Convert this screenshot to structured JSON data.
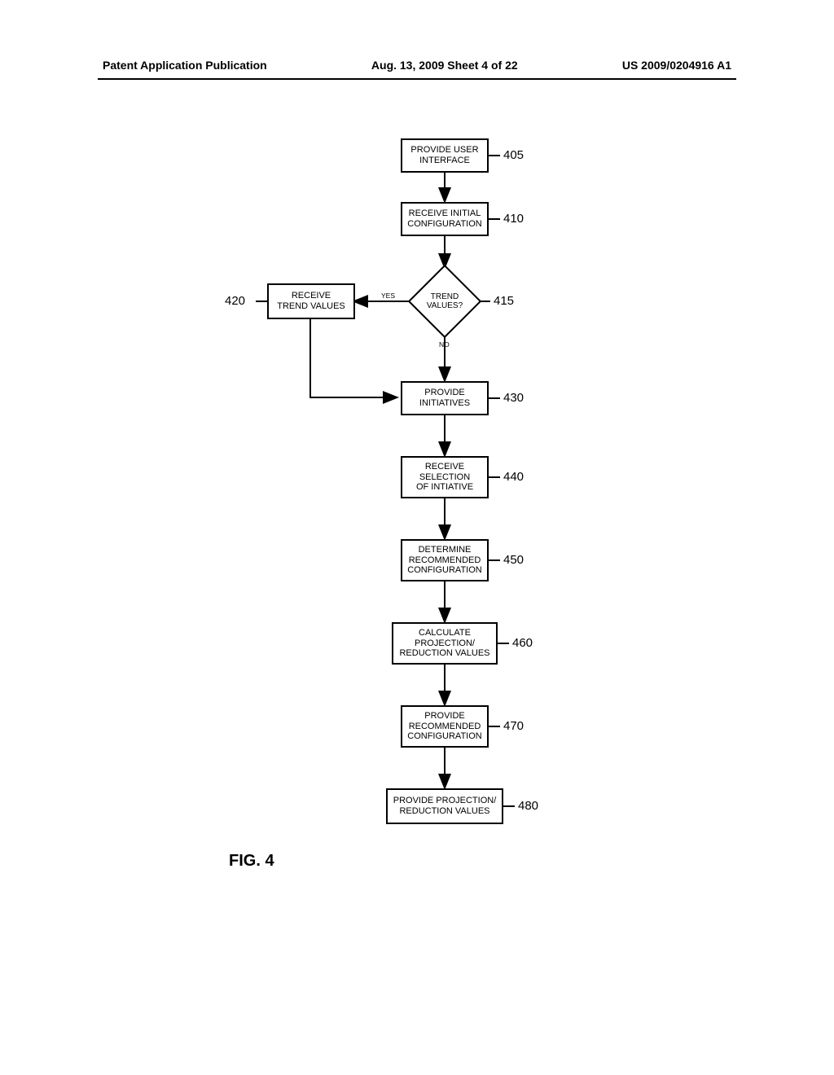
{
  "header": {
    "left": "Patent Application Publication",
    "mid": "Aug. 13, 2009  Sheet 4 of 22",
    "right": "US 2009/0204916 A1"
  },
  "figure_label": "FIG. 4",
  "nodes": {
    "n405": {
      "text": "PROVIDE USER\nINTERFACE",
      "ref": "405"
    },
    "n410": {
      "text": "RECEIVE INITIAL\nCONFIGURATION",
      "ref": "410"
    },
    "n415": {
      "text": "TREND\nVALUES?",
      "ref": "415"
    },
    "n420": {
      "text": "RECEIVE\nTREND VALUES",
      "ref": "420"
    },
    "n430": {
      "text": "PROVIDE\nINITIATIVES",
      "ref": "430"
    },
    "n440": {
      "text": "RECEIVE\nSELECTION\nOF INTIATIVE",
      "ref": "440"
    },
    "n450": {
      "text": "DETERMINE\nRECOMMENDED\nCONFIGURATION",
      "ref": "450"
    },
    "n460": {
      "text": "CALCULATE\nPROJECTION/\nREDUCTION VALUES",
      "ref": "460"
    },
    "n470": {
      "text": "PROVIDE\nRECOMMENDED\nCONFIGURATION",
      "ref": "470"
    },
    "n480": {
      "text": "PROVIDE PROJECTION/\nREDUCTION VALUES",
      "ref": "480"
    }
  },
  "labels": {
    "yes": "YES",
    "no": "NO"
  }
}
